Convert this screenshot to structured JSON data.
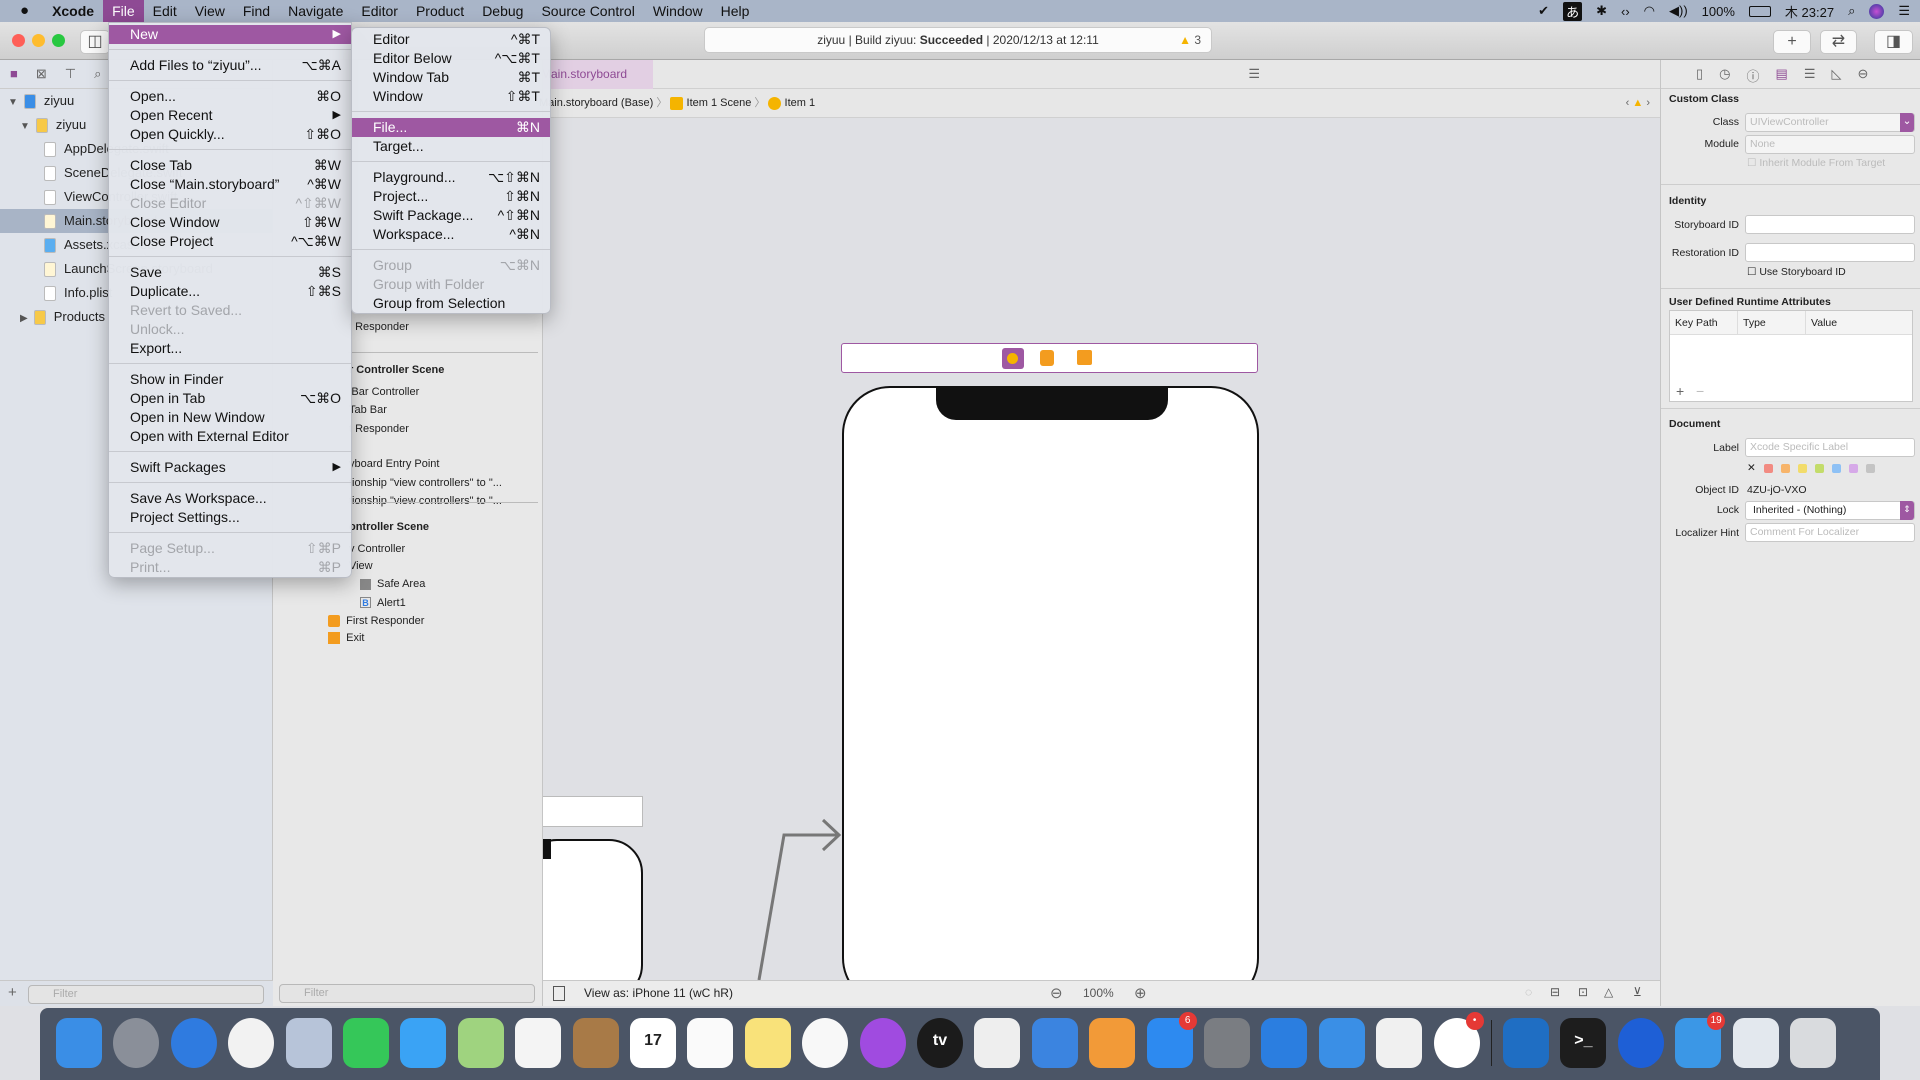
{
  "menubar": {
    "apple": "",
    "app": "Xcode",
    "items": [
      "File",
      "Edit",
      "View",
      "Find",
      "Navigate",
      "Editor",
      "Product",
      "Debug",
      "Source Control",
      "Window",
      "Help"
    ],
    "status": {
      "battery": "100%",
      "clock": "木 23:27",
      "input": "あ"
    }
  },
  "toolbar": {
    "status_project": "ziyuu | Build ziyuu: ",
    "status_result": "Succeeded",
    "status_time": " | 2020/12/13 at 12:11",
    "warnings": "3",
    "add": "+",
    "swap": "⇄"
  },
  "navigator": {
    "items": [
      {
        "label": "ziyuu",
        "icon": "project-icon",
        "disc": "▼"
      },
      {
        "label": "ziyuu",
        "icon": "folder-icon",
        "disc": "▼"
      },
      {
        "label": "AppDelegate.swift",
        "icon": "swift-file-icon"
      },
      {
        "label": "SceneDelegate.swift",
        "icon": "swift-file-icon"
      },
      {
        "label": "ViewController.swift",
        "icon": "swift-file-icon"
      },
      {
        "label": "Main.storyboard",
        "icon": "storyboard-icon",
        "selected": true
      },
      {
        "label": "Assets.xcassets",
        "icon": "assets-icon"
      },
      {
        "label": "LaunchScreen.storyboard",
        "icon": "storyboard-icon"
      },
      {
        "label": "Info.plist",
        "icon": "plist-icon"
      },
      {
        "label": "Products",
        "icon": "folder-icon",
        "disc": "▶"
      }
    ],
    "filter_placeholder": "Filter"
  },
  "outline": {
    "items": [
      "t Responder",
      "r Controller Scene",
      "Bar Controller",
      "Tab Bar",
      "t Responder",
      "yboard Entry Point",
      "tionship \"view controllers\" to \"...",
      "tionship \"view controllers\" to \"...",
      "ontroller Scene",
      "v Controller",
      "View",
      "Safe Area",
      "Alert1",
      "First Responder",
      "Exit"
    ],
    "filter_placeholder": "Filter"
  },
  "editor": {
    "tab": "Main.storyboard",
    "breadcrumb": [
      "Main.storyboard (Base)",
      "Item 1 Scene",
      "Item 1"
    ],
    "view_as": "View as: iPhone 11 (wC hR)",
    "zoom": "100%"
  },
  "file_menu": [
    {
      "label": "New",
      "submenu": true,
      "highlight": true
    },
    {
      "sep": true
    },
    {
      "label": "Add Files to “ziyuu”...",
      "shortcut": "⌥⌘A"
    },
    {
      "sep": true
    },
    {
      "label": "Open...",
      "shortcut": "⌘O"
    },
    {
      "label": "Open Recent",
      "submenu": true
    },
    {
      "label": "Open Quickly...",
      "shortcut": "⇧⌘O"
    },
    {
      "sep": true
    },
    {
      "label": "Close Tab",
      "shortcut": "⌘W"
    },
    {
      "label": "Close “Main.storyboard”",
      "shortcut": "^⌘W"
    },
    {
      "label": "Close Editor",
      "shortcut": "^⇧⌘W",
      "disabled": true
    },
    {
      "label": "Close Window",
      "shortcut": "⇧⌘W"
    },
    {
      "label": "Close Project",
      "shortcut": "^⌥⌘W"
    },
    {
      "sep": true
    },
    {
      "label": "Save",
      "shortcut": "⌘S"
    },
    {
      "label": "Duplicate...",
      "shortcut": "⇧⌘S"
    },
    {
      "label": "Revert to Saved...",
      "disabled": true
    },
    {
      "label": "Unlock...",
      "disabled": true
    },
    {
      "label": "Export..."
    },
    {
      "sep": true
    },
    {
      "label": "Show in Finder"
    },
    {
      "label": "Open in Tab",
      "shortcut": "⌥⌘O"
    },
    {
      "label": "Open in New Window"
    },
    {
      "label": "Open with External Editor"
    },
    {
      "sep": true
    },
    {
      "label": "Swift Packages",
      "submenu": true
    },
    {
      "sep": true
    },
    {
      "label": "Save As Workspace..."
    },
    {
      "label": "Project Settings..."
    },
    {
      "sep": true
    },
    {
      "label": "Page Setup...",
      "shortcut": "⇧⌘P",
      "disabled": true
    },
    {
      "label": "Print...",
      "shortcut": "⌘P",
      "disabled": true
    }
  ],
  "new_menu": [
    {
      "label": "Editor",
      "shortcut": "^⌘T"
    },
    {
      "label": "Editor Below",
      "shortcut": "^⌥⌘T"
    },
    {
      "label": "Window Tab",
      "shortcut": "⌘T"
    },
    {
      "label": "Window",
      "shortcut": "⇧⌘T"
    },
    {
      "sep": true
    },
    {
      "label": "File...",
      "shortcut": "⌘N",
      "highlight": true
    },
    {
      "label": "Target..."
    },
    {
      "sep": true
    },
    {
      "label": "Playground...",
      "shortcut": "⌥⇧⌘N"
    },
    {
      "label": "Project...",
      "shortcut": "⇧⌘N"
    },
    {
      "label": "Swift Package...",
      "shortcut": "^⇧⌘N"
    },
    {
      "label": "Workspace...",
      "shortcut": "^⌘N"
    },
    {
      "sep": true
    },
    {
      "label": "Group",
      "shortcut": "⌥⌘N",
      "disabled": true
    },
    {
      "label": "Group with Folder",
      "disabled": true
    },
    {
      "label": "Group from Selection"
    }
  ],
  "inspector": {
    "custom_class": "Custom Class",
    "class_label": "Class",
    "class_placeholder": "UIViewController",
    "module_label": "Module",
    "module_placeholder": "None",
    "inherit": "Inherit Module From Target",
    "identity": "Identity",
    "storyboard_id": "Storyboard ID",
    "restoration_id": "Restoration ID",
    "use_storyboard_id": "Use Storyboard ID",
    "udra": "User Defined Runtime Attributes",
    "cols": [
      "Key Path",
      "Type",
      "Value"
    ],
    "document": "Document",
    "label_label": "Label",
    "label_placeholder": "Xcode Specific Label",
    "object_id_label": "Object ID",
    "object_id": "4ZU-jO-VXO",
    "lock_label": "Lock",
    "lock_value": "Inherited - (Nothing)",
    "hint_label": "Localizer Hint",
    "hint_placeholder": "Comment For Localizer",
    "label_colors": [
      "#f28b82",
      "#f7b46a",
      "#f2dc6b",
      "#c3dc6a",
      "#8ec1f5",
      "#d6a9e8",
      "#c4c4c4"
    ]
  },
  "colors": {
    "accent": "#9e58a2"
  },
  "dock": [
    {
      "name": "finder",
      "c": "#3a8ee6"
    },
    {
      "name": "launchpad",
      "c": "#8a8f99"
    },
    {
      "name": "safari",
      "c": "#2f7be0"
    },
    {
      "name": "chrome",
      "c": "#f2f2f2"
    },
    {
      "name": "preview",
      "c": "#b7c4d9"
    },
    {
      "name": "facetime",
      "c": "#35c759"
    },
    {
      "name": "messages",
      "c": "#3aa3f5"
    },
    {
      "name": "maps",
      "c": "#9fd37f"
    },
    {
      "name": "photos",
      "c": "#f4f4f4"
    },
    {
      "name": "contacts",
      "c": "#a87a47"
    },
    {
      "name": "calendar",
      "c": "#ffffff",
      "text": "17"
    },
    {
      "name": "reminders",
      "c": "#fafafa"
    },
    {
      "name": "notes",
      "c": "#f9e27a"
    },
    {
      "name": "music",
      "c": "#f8f8f8"
    },
    {
      "name": "podcasts",
      "c": "#a04be0"
    },
    {
      "name": "tv",
      "c": "#1b1b1b",
      "text": "tv"
    },
    {
      "name": "numbers",
      "c": "#eeeeee"
    },
    {
      "name": "keynote",
      "c": "#3b84e0"
    },
    {
      "name": "pages",
      "c": "#f29a38"
    },
    {
      "name": "app-store",
      "c": "#2d8af0",
      "badge": "6"
    },
    {
      "name": "system-preferences",
      "c": "#7a7d82"
    },
    {
      "name": "xcode",
      "c": "#2b7ee0"
    },
    {
      "name": "instruments",
      "c": "#3a8fe6"
    },
    {
      "name": "textedit",
      "c": "#f0f0f0"
    },
    {
      "name": "slack",
      "c": "#ffffff",
      "badge": "•"
    },
    {
      "name": "trello",
      "c": "#1f6ec3"
    },
    {
      "name": "terminal",
      "c": "#1d1d1d",
      "text": ">_"
    },
    {
      "name": "sourcetree",
      "c": "#1e5fd6"
    },
    {
      "name": "twitter",
      "c": "#3b97e6",
      "badge": "19"
    },
    {
      "name": "simulator",
      "c": "#e3e8ee"
    },
    {
      "name": "trash",
      "c": "#d9dbde"
    }
  ]
}
